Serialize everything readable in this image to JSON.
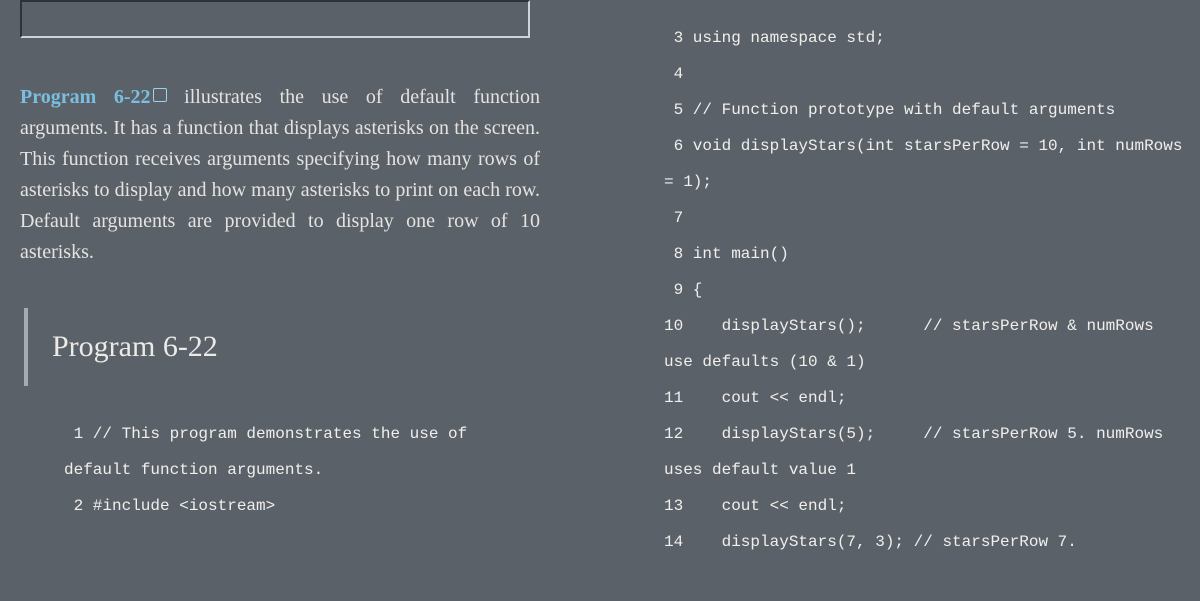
{
  "search": {
    "value": ""
  },
  "para": {
    "link_text": "Program 6-22",
    "body_after_link": " illustrates the use of default function arguments. It has a function that displays asterisks on the screen. This function receives arguments specifying how many rows of asterisks to display and how many asterisks to print on each row. Default arguments are provided to display one row of 10 asterisks."
  },
  "heading": "Program 6-22",
  "code_left": [
    {
      "n": "1",
      "t": "// This program demonstrates the use of default function arguments."
    },
    {
      "n": "2",
      "t": "#include <iostream>"
    }
  ],
  "code_right": [
    {
      "n": "3",
      "t": "using namespace std;"
    },
    {
      "n": "4",
      "t": ""
    },
    {
      "n": "5",
      "t": "// Function prototype with default arguments"
    },
    {
      "n": "6",
      "t": "void displayStars(int starsPerRow = 10, int numRows = 1);"
    },
    {
      "n": "7",
      "t": ""
    },
    {
      "n": "8",
      "t": "int main()"
    },
    {
      "n": "9",
      "t": "{"
    },
    {
      "n": "10",
      "t": "   displayStars();      // starsPerRow & numRows use defaults (10 & 1)"
    },
    {
      "n": "11",
      "t": "   cout << endl;"
    },
    {
      "n": "12",
      "t": "   displayStars(5);     // starsPerRow 5. numRows uses default value 1"
    },
    {
      "n": "13",
      "t": "   cout << endl;"
    },
    {
      "n": "14",
      "t": "   displayStars(7, 3); // starsPerRow 7."
    }
  ]
}
